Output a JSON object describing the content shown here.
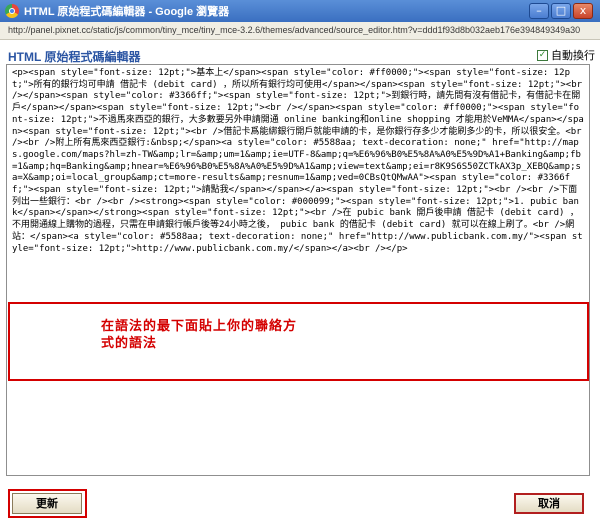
{
  "window": {
    "title": "HTML 原始程式碼編輯器 - Google 瀏覽器",
    "minimize_glyph": "–",
    "maximize_glyph": "□",
    "close_glyph": "x"
  },
  "address": {
    "url": "http://panel.pixnet.cc/static/js/common/tiny_mce/tiny_mce-3.2.6/themes/advanced/source_editor.htm?v=ddd1f93d8b032aeb176e394849349a30"
  },
  "dialog": {
    "title": "HTML 原始程式碼編輯器",
    "wrap": {
      "label": "自動換行",
      "checked": true,
      "check_glyph": "✓"
    }
  },
  "editor": {
    "source": "<p><span style=\"font-size: 12pt;\">基本上</span><span style=\"color: #ff0000;\"><span style=\"font-size: 12pt;\">所有的銀行均可申請 借記卡 (debit card) ，所以所有銀行均可使用</span></span><span style=\"font-size: 12pt;\"><br /></span><span style=\"color: #3366ff;\"><span style=\"font-size: 12pt;\">到銀行時，請先問有沒有借記卡，有借記卡在開戶</span></span><span style=\"font-size: 12pt;\"><br /></span><span style=\"color: #ff0000;\"><span style=\"font-size: 12pt;\">不過馬來西亞的銀行，大多數要另外申請開通 online banking和online shopping 才能用於VeMMA</span></span><span style=\"font-size: 12pt;\"><br />借記卡爲能綁銀行開戶就能申請的卡，是你銀行存多少才能刷多少的卡，所以很安全。<br /><br />附上所有馬來西亞銀行:&nbsp;</span><a style=\"color: #5588aa; text-decoration: none;\" href=\"http://maps.google.com/maps?hl=zh-TW&amp;lr=&amp;um=1&amp;ie=UTF-8&amp;q=%E6%96%B0%E5%8A%A0%E5%9D%A1+Banking&amp;fb=1&amp;hq=Banking&amp;hnear=%E6%96%B0%E5%8A%A0%E5%9D%A1&amp;view=text&amp;ei=r8K9S6S50ZCTkAX3p_XEBQ&amp;sa=X&amp;oi=local_group&amp;ct=more-results&amp;resnum=1&amp;ved=0CBsQtQMwAA\"><span style=\"color: #3366ff;\"><span style=\"font-size: 12pt;\">請點我</span></span></a><span style=\"font-size: 12pt;\"><br /><br />下面列出一些銀行：<br /><br /><strong><span style=\"color: #000099;\"><span style=\"font-size: 12pt;\">1. pubic bank</span></span></strong><span style=\"font-size: 12pt;\"><br />在 pubic bank 開戶後申請 借記卡 (debit card) ，不用開通線上購物的過程，只需在申請銀行帳戶後等24小時之後， pubic bank 的借記卡 (debit card) 就可以在線上刷了。<br />網站：</span><a style=\"color: #5588aa; text-decoration: none;\" href=\"http://www.publicbank.com.my/\"><span style=\"font-size: 12pt;\">http://www.publicbank.com.my/</span></a><br /></p>"
  },
  "annotation": {
    "note": "在語法的最下面貼上你的聯絡方式的語法"
  },
  "buttons": {
    "update": "更新",
    "cancel": "取消"
  }
}
